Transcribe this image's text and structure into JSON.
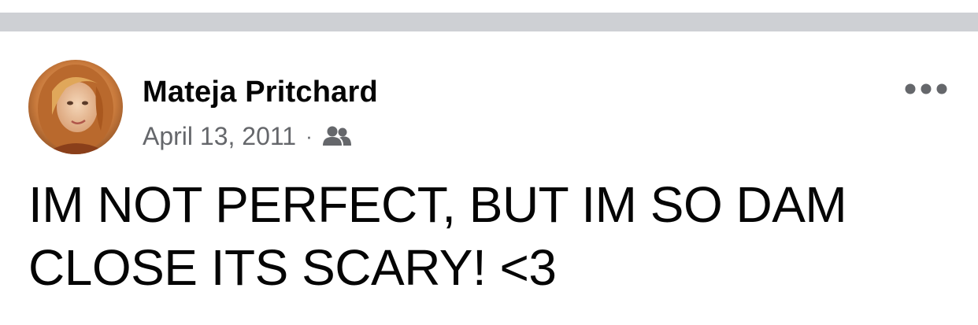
{
  "post": {
    "author": {
      "name": "Mateja Pritchard",
      "avatar_icon": "profile-photo"
    },
    "timestamp": "April 13, 2011",
    "separator": "·",
    "audience_icon": "friends-icon",
    "more_icon": "more-options-icon",
    "text": "IM NOT PERFECT, BUT IM SO DAM CLOSE ITS SCARY! <3"
  },
  "colors": {
    "divider": "#ced0d4",
    "primary_text": "#050505",
    "secondary_text": "#65676b"
  }
}
